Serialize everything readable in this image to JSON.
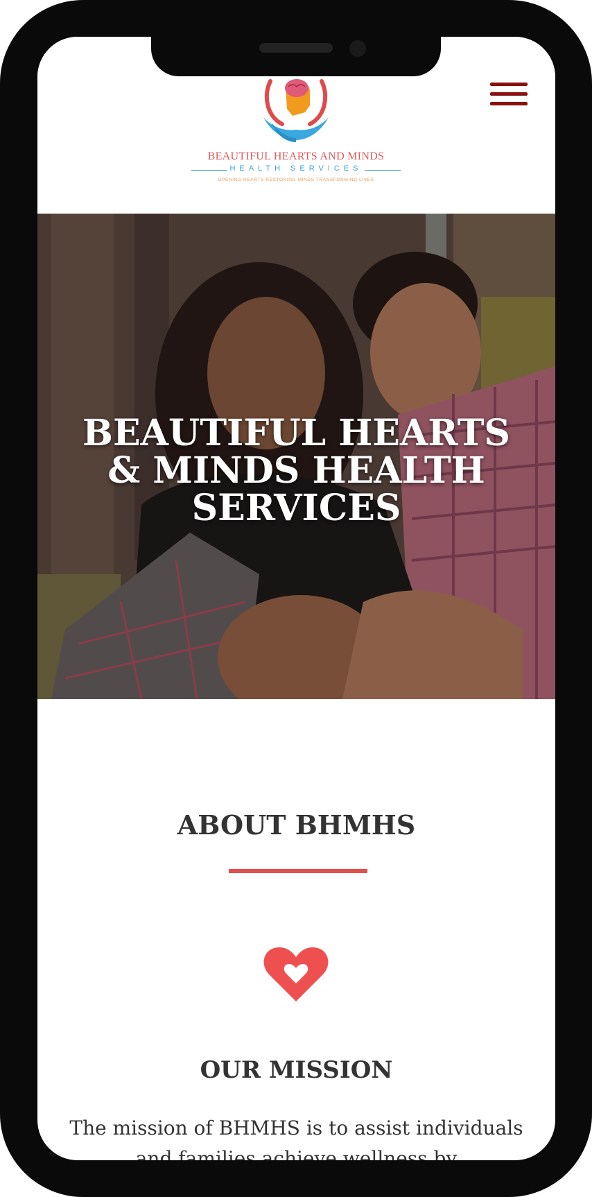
{
  "header": {
    "logo": {
      "name": "BEAUTIFUL HEARTS AND MINDS",
      "subtitle": "HEALTH SERVICES",
      "tagline": "OPENING HEARTS RESTORING MINDS TRANSFORMING LIVES"
    },
    "menu_icon": "hamburger-menu-icon"
  },
  "hero": {
    "title": "BEAUTIFUL HEARTS & MINDS HEALTH SERVICES"
  },
  "about": {
    "heading": "ABOUT BHMHS",
    "icon": "heart-icon",
    "mission_heading": "OUR MISSION",
    "mission_text": "The mission of BHMHS is to assist individuals and families achieve wellness by"
  },
  "colors": {
    "accent": "#e05050",
    "menu": "#8b1010",
    "text": "#333333"
  }
}
